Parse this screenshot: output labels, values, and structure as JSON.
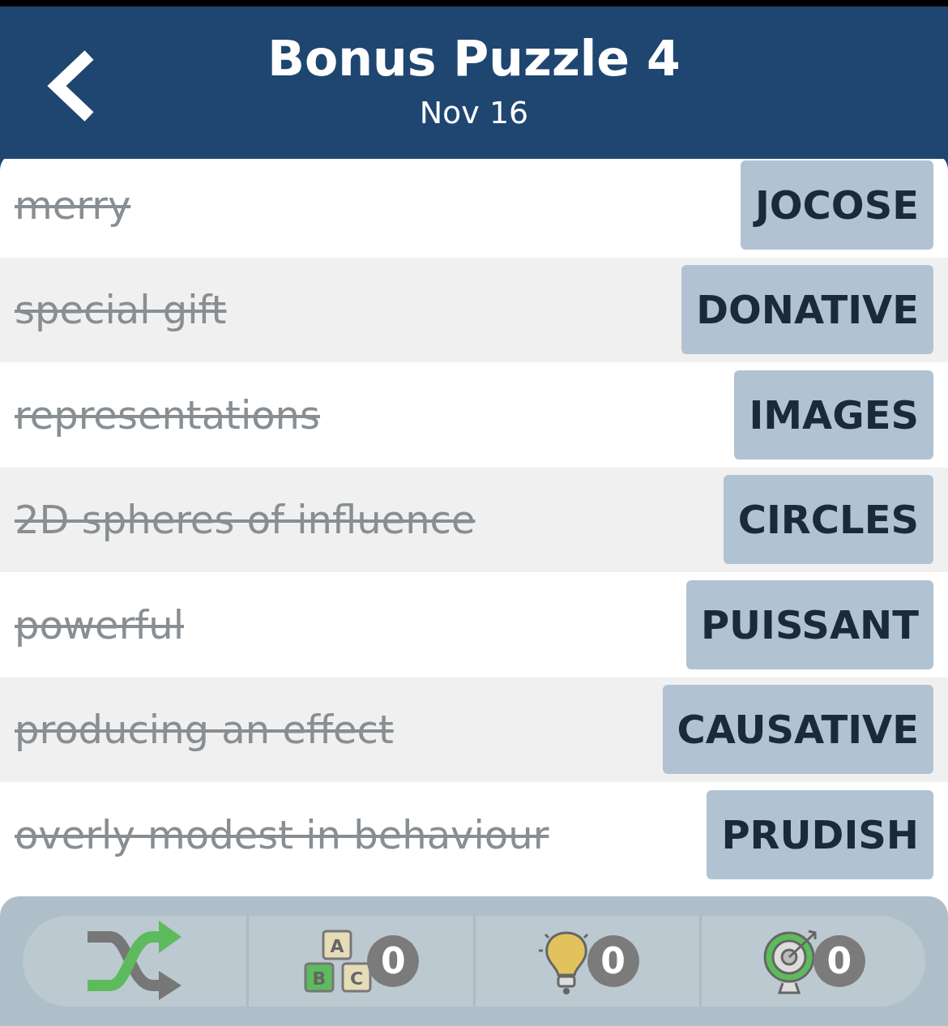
{
  "header": {
    "title": "Bonus Puzzle 4",
    "date": "Nov 16"
  },
  "rows": [
    {
      "clue": "merry",
      "answer": "JOCOSE",
      "solved": true
    },
    {
      "clue": "special gift",
      "answer": "DONATIVE",
      "solved": true
    },
    {
      "clue": "representations",
      "answer": "IMAGES",
      "solved": true
    },
    {
      "clue": "2D spheres of influence",
      "answer": "CIRCLES",
      "solved": true
    },
    {
      "clue": "powerful",
      "answer": "PUISSANT",
      "solved": true
    },
    {
      "clue": "producing an effect",
      "answer": "CAUSATIVE",
      "solved": true
    },
    {
      "clue": "overly modest in behaviour",
      "answer": "PRUDISH",
      "solved": true
    }
  ],
  "toolbar": [
    {
      "kind": "shuffle"
    },
    {
      "kind": "letters",
      "letters": [
        "A",
        "B",
        "C"
      ],
      "count": "0"
    },
    {
      "kind": "hint",
      "count": "0"
    },
    {
      "kind": "target",
      "count": "0"
    }
  ]
}
